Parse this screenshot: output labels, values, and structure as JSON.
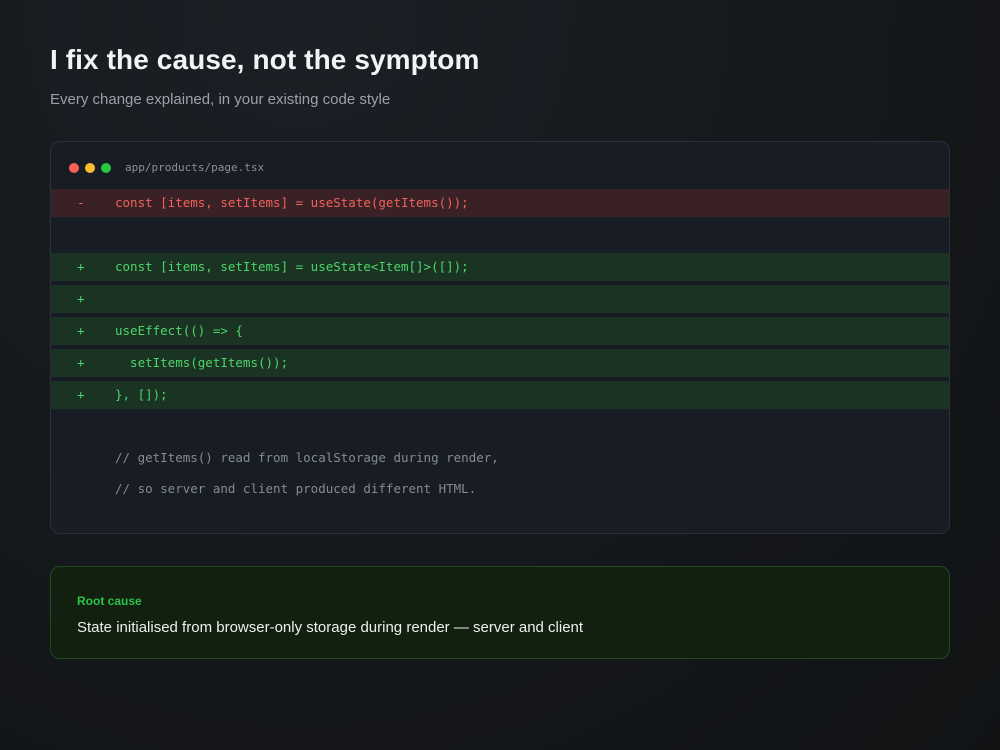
{
  "header": {
    "title": "I fix the cause, not the symptom",
    "subtitle": "Every change explained, in your existing code style"
  },
  "code_window": {
    "filename": "app/products/page.tsx",
    "lines": [
      {
        "type": "removed",
        "marker": "-",
        "code": "const [items, setItems] = useState(getItems());"
      },
      {
        "type": "blank",
        "marker": "",
        "code": ""
      },
      {
        "type": "added",
        "marker": "+",
        "code": "const [items, setItems] = useState<Item[]>([]);"
      },
      {
        "type": "added",
        "marker": "+",
        "code": ""
      },
      {
        "type": "added",
        "marker": "+",
        "code": "useEffect(() => {"
      },
      {
        "type": "added",
        "marker": "+",
        "code": "  setItems(getItems());"
      },
      {
        "type": "added",
        "marker": "+",
        "code": "}, []);"
      },
      {
        "type": "blank",
        "marker": "",
        "code": ""
      },
      {
        "type": "comment",
        "marker": "",
        "code": "// getItems() read from localStorage during render,"
      },
      {
        "type": "comment",
        "marker": "",
        "code": "// so server and client produced different HTML."
      }
    ]
  },
  "root_cause": {
    "label": "Root cause",
    "text": "State initialised from browser-only storage during render — server and client"
  },
  "colors": {
    "removed": "#f0625c",
    "added": "#4cd66a",
    "accent": "#2fc14a"
  }
}
